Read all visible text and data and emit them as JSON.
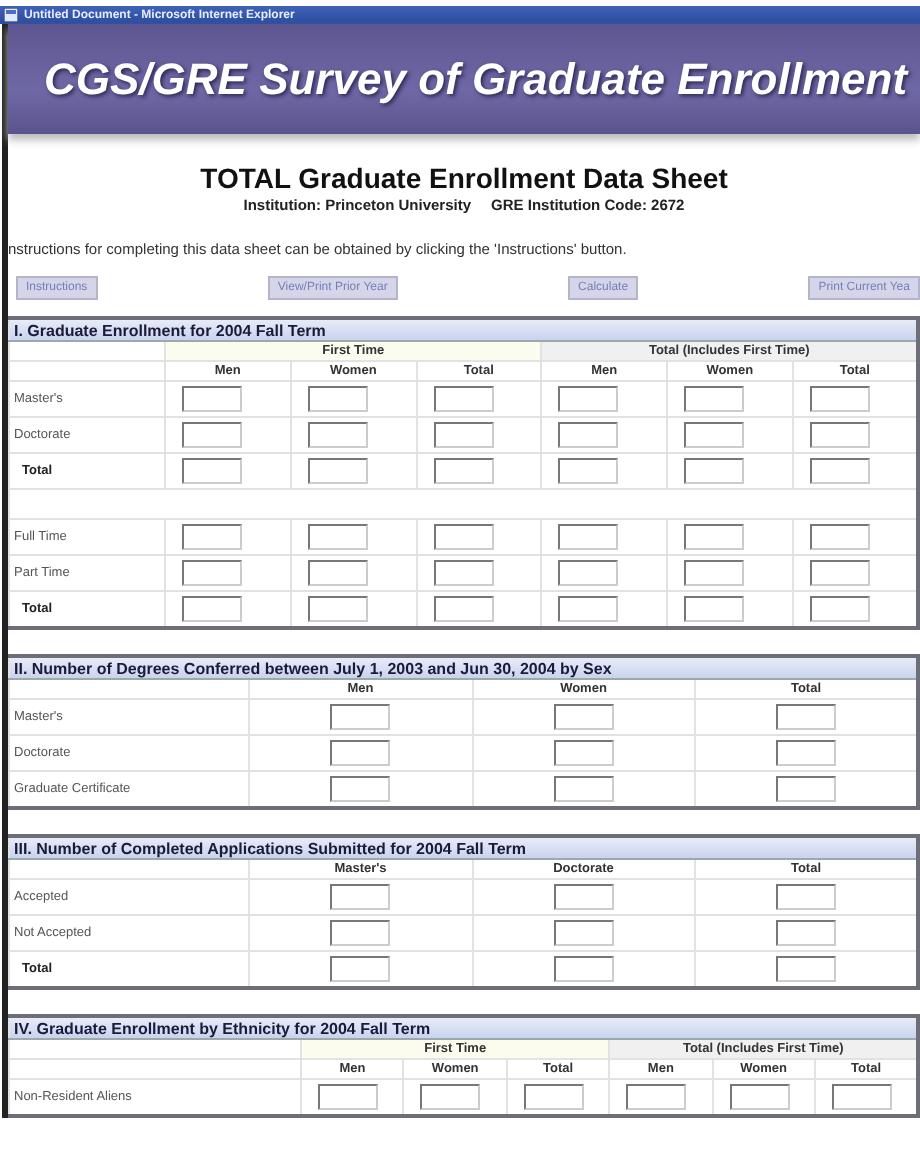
{
  "window": {
    "title": "Untitled Document - Microsoft Internet Explorer"
  },
  "banner": {
    "title": "CGS/GRE Survey of Graduate Enrollment"
  },
  "heading": {
    "title": "TOTAL Graduate Enrollment Data Sheet",
    "institution": "Institution: Princeton University",
    "code": "GRE Institution Code: 2672"
  },
  "instructions_text": "nstructions for completing this data sheet can be obtained by clicking the 'Instructions' button.",
  "buttons": [
    "Instructions",
    "View/Print Prior Year",
    "Calculate",
    "Print Current Yea"
  ],
  "sections": [
    {
      "title": "I. Graduate Enrollment for 2004 Fall Term",
      "kind": "wide",
      "groups": [
        {
          "label": "First Time",
          "kind": "first"
        },
        {
          "label": "Total (Includes First Time)",
          "kind": "total"
        }
      ],
      "columns": [
        "Men",
        "Women",
        "Total",
        "Men",
        "Women",
        "Total"
      ],
      "rows": [
        {
          "kind": "entry",
          "label": "Master's"
        },
        {
          "kind": "entry",
          "label": "Doctorate"
        },
        {
          "kind": "total",
          "label": "Total"
        },
        {
          "kind": "spacer"
        },
        {
          "kind": "entry",
          "label": "Full Time"
        },
        {
          "kind": "entry",
          "label": "Part Time"
        },
        {
          "kind": "total",
          "label": "Total"
        }
      ]
    },
    {
      "title": "II. Number of Degrees Conferred between July 1, 2003 and Jun 30, 2004 by Sex",
      "kind": "narrow",
      "columns": [
        "Men",
        "Women",
        "Total"
      ],
      "rows": [
        {
          "kind": "entry",
          "label": "Master's"
        },
        {
          "kind": "entry",
          "label": "Doctorate"
        },
        {
          "kind": "entry",
          "label": "Graduate Certificate"
        }
      ]
    },
    {
      "title": "III. Number of Completed Applications Submitted for 2004 Fall Term",
      "kind": "narrow",
      "columns": [
        "Master's",
        "Doctorate",
        "Total"
      ],
      "rows": [
        {
          "kind": "entry",
          "label": "Accepted"
        },
        {
          "kind": "entry",
          "label": "Not Accepted"
        },
        {
          "kind": "total",
          "label": "Total"
        }
      ]
    },
    {
      "title": "IV. Graduate Enrollment by Ethnicity for 2004 Fall Term",
      "kind": "ethnic",
      "groups": [
        {
          "label": "First Time",
          "kind": "first"
        },
        {
          "label": "Total (Includes First Time)",
          "kind": "total"
        }
      ],
      "columns": [
        "Men",
        "Women",
        "Total",
        "Men",
        "Women",
        "Total"
      ],
      "rows": [
        {
          "kind": "entry",
          "label": "Non-Resident Aliens"
        }
      ]
    }
  ]
}
